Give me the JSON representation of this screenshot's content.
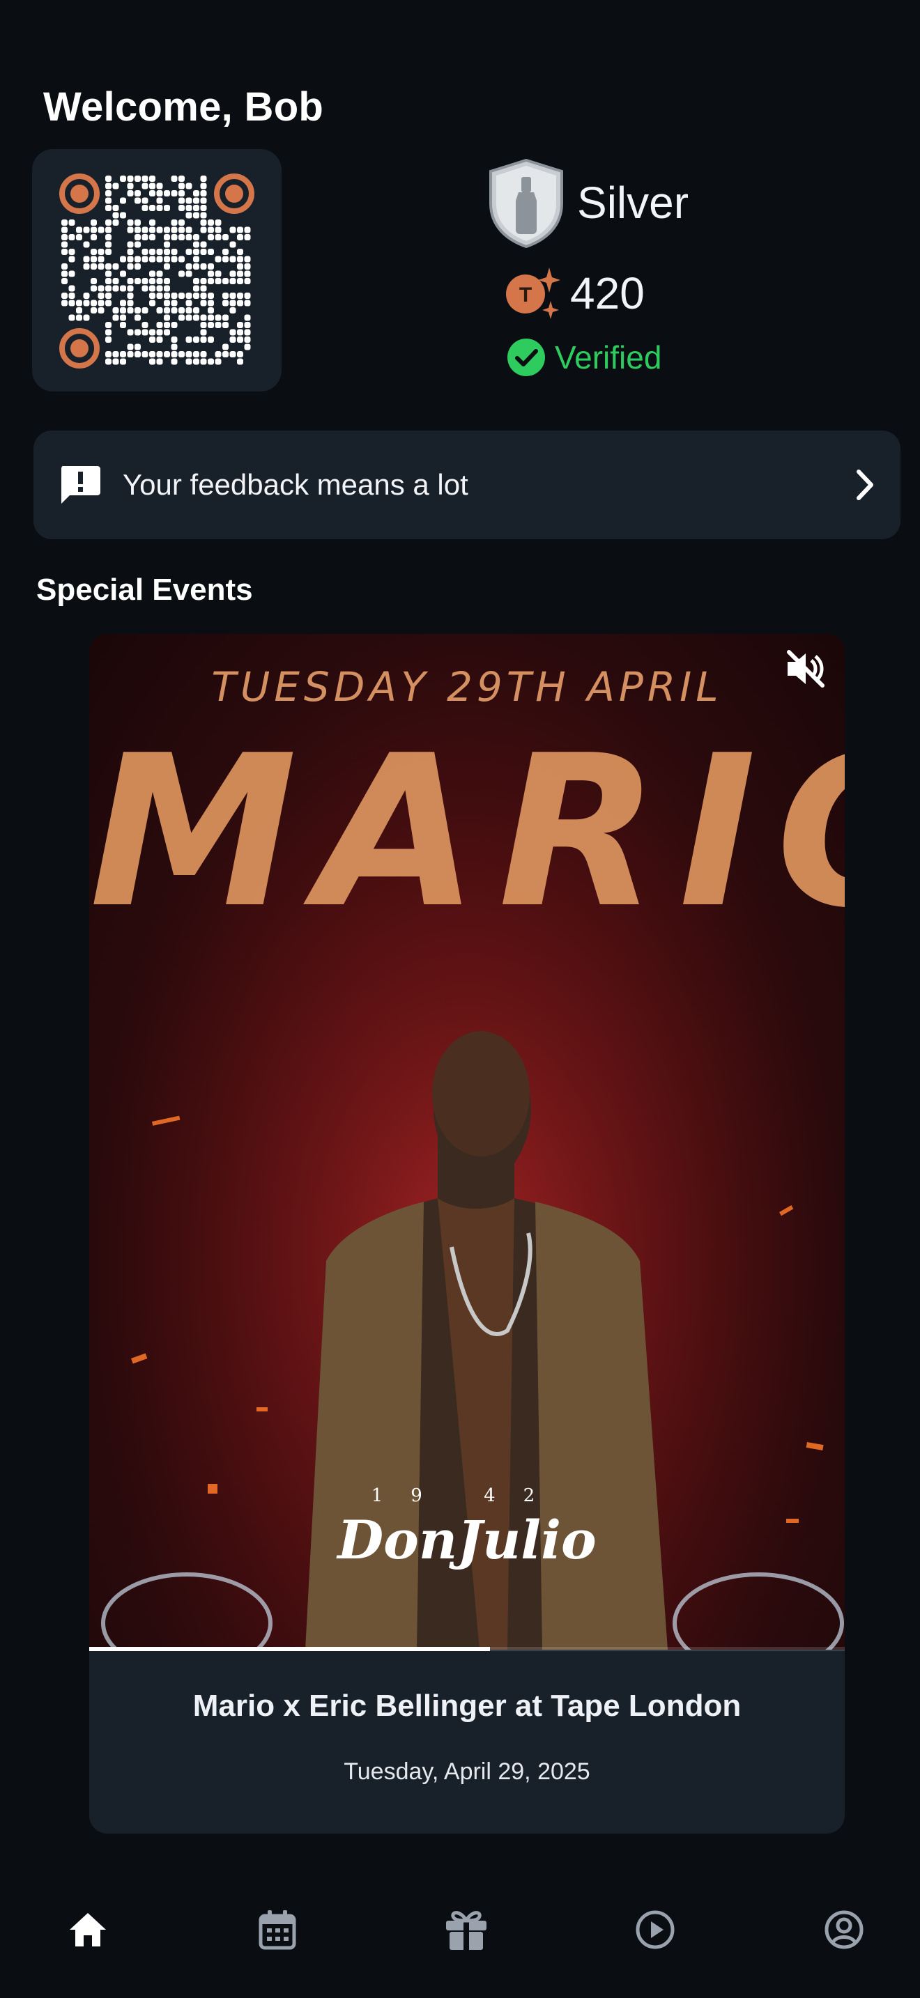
{
  "header": {
    "welcome": "Welcome, Bob"
  },
  "membership": {
    "tier": "Silver",
    "tier_icon": "bottle-shield-icon",
    "points": "420",
    "points_icon": "token-sparkle-icon",
    "status": "Verified",
    "status_color": "#2ecc5e",
    "accent_color": "#d4764a"
  },
  "feedback": {
    "label": "Your feedback means a lot"
  },
  "special_events": {
    "title": "Special Events",
    "items": [
      {
        "poster_date": "TUESDAY 29TH APRIL",
        "poster_headline": "MARIO",
        "sponsor_year_left": "19",
        "sponsor_year_right": "42",
        "sponsor_name": "DonJulio",
        "title": "Mario x Eric Bellinger at Tape London",
        "date": "Tuesday, April 29, 2025",
        "video_progress": 0.53,
        "muted": true
      }
    ]
  },
  "nav": {
    "items": [
      {
        "icon": "home-icon",
        "active": true
      },
      {
        "icon": "calendar-icon",
        "active": false
      },
      {
        "icon": "gift-icon",
        "active": false
      },
      {
        "icon": "play-circle-icon",
        "active": false
      },
      {
        "icon": "profile-icon",
        "active": false
      }
    ],
    "active_color": "#ffffff",
    "inactive_color": "#9aa3ad"
  }
}
